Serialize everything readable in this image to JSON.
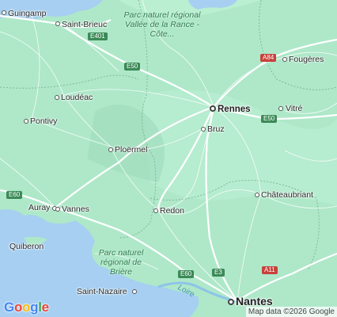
{
  "map": {
    "cities": [
      {
        "name": "Guingamp"
      },
      {
        "name": "Saint-Brieuc"
      },
      {
        "name": "Fougères"
      },
      {
        "name": "Loudéac"
      },
      {
        "name": "Rennes"
      },
      {
        "name": "Vitré"
      },
      {
        "name": "Pontivy"
      },
      {
        "name": "Bruz"
      },
      {
        "name": "Ploërmel"
      },
      {
        "name": "Châteaubriant"
      },
      {
        "name": "Auray"
      },
      {
        "name": "Vannes"
      },
      {
        "name": "Redon"
      },
      {
        "name": "Quiberon"
      },
      {
        "name": "Saint-Nazaire"
      },
      {
        "name": "Nantes"
      }
    ],
    "parks": [
      {
        "name": "Parc naturel régional Vallée de la Rance - Côte..."
      },
      {
        "name": "Parc naturel régional de Brière"
      }
    ],
    "roads": [
      "E401",
      "E50",
      "A84",
      "E50",
      "E60",
      "E60",
      "E3",
      "A11"
    ],
    "water": {
      "river": "Loire"
    },
    "logo": {
      "letters": [
        "G",
        "o",
        "o",
        "g",
        "l",
        "e"
      ]
    },
    "attribution": "Map data ©2026 Google",
    "colors": {
      "land": "#a8e6c5",
      "sea": "#a6cff1",
      "road_major": "#ffffff",
      "shield_red": "#c8413b",
      "shield_green": "#3b8a57"
    }
  }
}
